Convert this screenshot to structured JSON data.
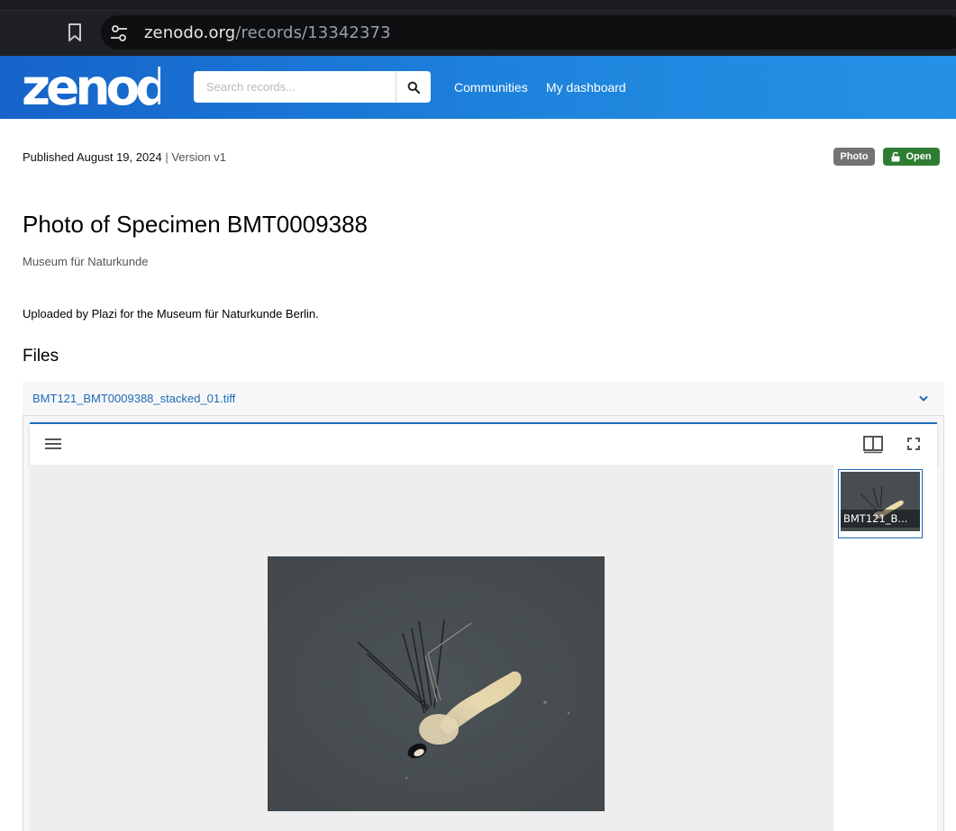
{
  "browser": {
    "url_host": "zenodo.org",
    "url_path": "/records/13342373"
  },
  "header": {
    "logo_text": "zenodo",
    "search_placeholder": "Search records...",
    "nav": [
      "Communities",
      "My dashboard"
    ]
  },
  "record": {
    "published": "Published August 19, 2024",
    "separator": "|",
    "version": "Version v1",
    "badges": {
      "type": "Photo",
      "access": "Open"
    },
    "title": "Photo of Specimen BMT0009388",
    "creator": "Museum für Naturkunde",
    "description": "Uploaded by Plazi for the Museum für Naturkunde Berlin."
  },
  "files": {
    "heading": "Files",
    "file_name": "BMT121_BMT0009388_stacked_01.tiff",
    "thumbnail_caption": "BMT121_B..."
  },
  "colors": {
    "header_start": "#1563c9",
    "header_end": "#2491e6",
    "open_badge": "#2e7d32",
    "photo_badge": "#737373",
    "link": "#1e6bb8"
  }
}
